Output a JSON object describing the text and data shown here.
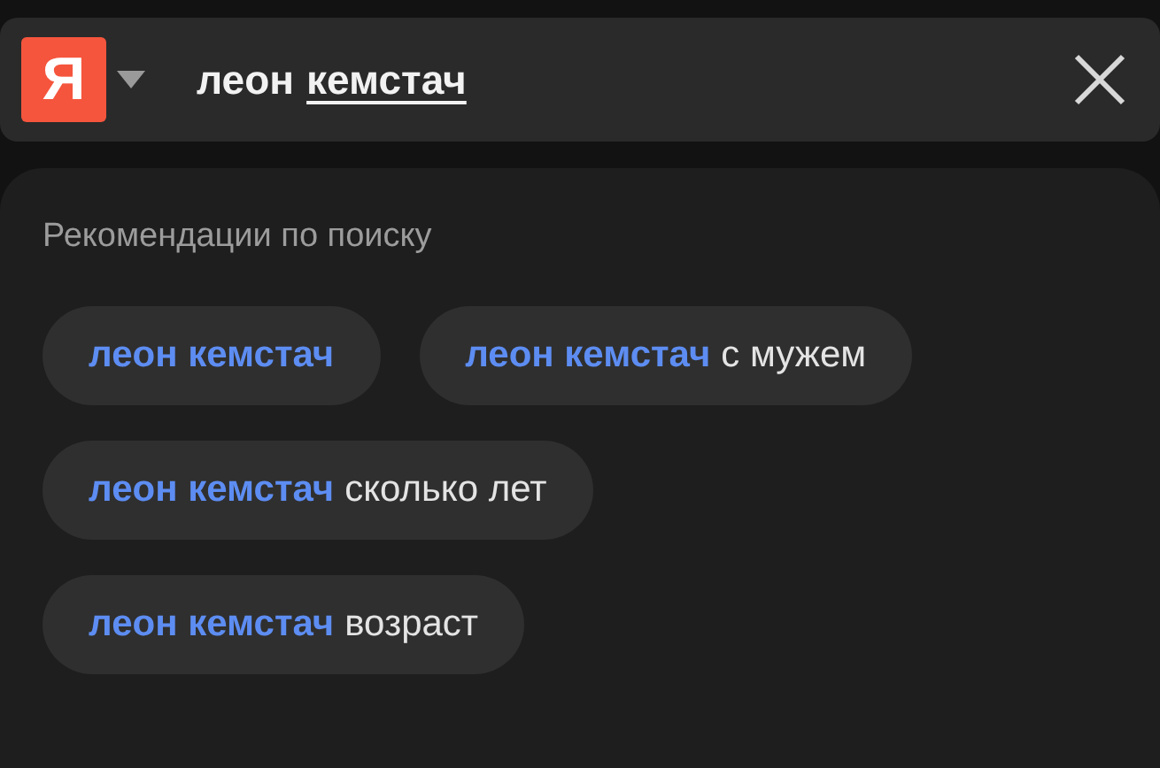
{
  "search": {
    "logo": "Я",
    "query": [
      {
        "text": "леон",
        "underlined": false
      },
      {
        "text": "кемстач",
        "underlined": true
      }
    ]
  },
  "suggestions": {
    "title": "Рекомендации по поиску",
    "rows": [
      [
        {
          "match": "леон кемстач"
        },
        {
          "match": "леон кемстач",
          "rest": "с мужем"
        }
      ],
      [
        {
          "match": "леон кемстач",
          "rest": "сколько лет"
        }
      ],
      [
        {
          "match": "леон кемстач",
          "rest": "возраст"
        }
      ]
    ]
  }
}
